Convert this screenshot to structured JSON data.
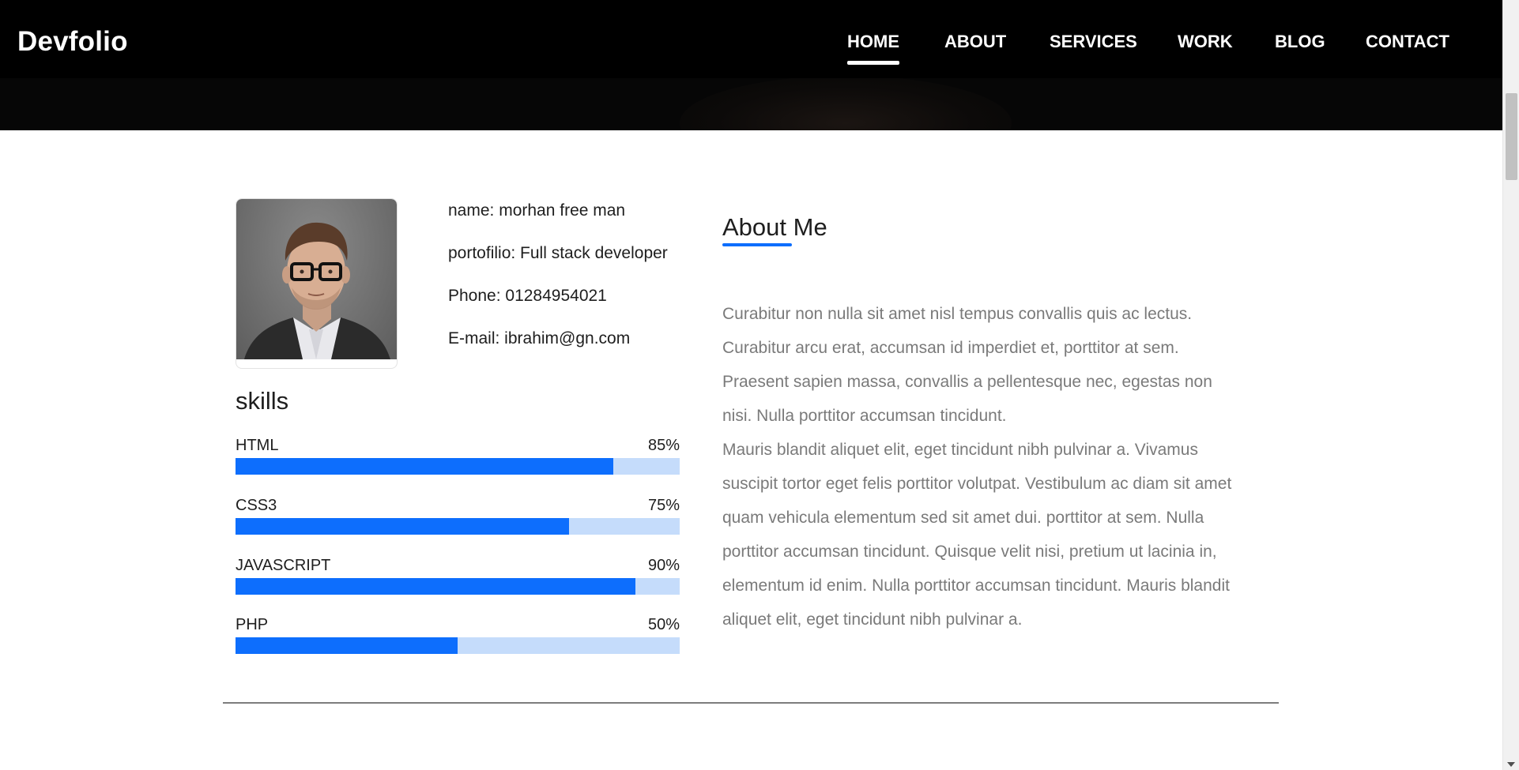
{
  "brand": "Devfolio",
  "nav": {
    "items": [
      {
        "label": "HOME",
        "active": true
      },
      {
        "label": "ABOUT",
        "active": false
      },
      {
        "label": "SERVICES",
        "active": false
      },
      {
        "label": "WORK",
        "active": false
      },
      {
        "label": "BLOG",
        "active": false
      },
      {
        "label": "CONTACT",
        "active": false
      }
    ]
  },
  "profile": {
    "avatar_alt": "profile photo",
    "name_line": "name: morhan free man",
    "portfolio_line": "portofilio: Full stack developer",
    "phone_line": "Phone: 01284954021",
    "email_line": "E-mail: ibrahim@gn.com"
  },
  "skills": {
    "title": "skills",
    "items": [
      {
        "label": "HTML",
        "percent_text": "85%",
        "value": 85
      },
      {
        "label": "CSS3",
        "percent_text": "75%",
        "value": 75
      },
      {
        "label": "JAVASCRIPT",
        "percent_text": "90%",
        "value": 90
      },
      {
        "label": "PHP",
        "percent_text": "50%",
        "value": 50
      }
    ]
  },
  "about": {
    "title": "About Me",
    "paragraphs": [
      "Curabitur non nulla sit amet nisl tempus convallis quis ac lectus. Curabitur arcu erat, accumsan id imperdiet et, porttitor at sem. Praesent sapien massa, convallis a pellentesque nec, egestas non nisi. Nulla porttitor accumsan tincidunt.",
      "Mauris blandit aliquet elit, eget tincidunt nibh pulvinar a. Vivamus suscipit tortor eget felis porttitor volutpat. Vestibulum ac diam sit amet quam vehicula elementum sed sit amet dui. porttitor at sem. Nulla porttitor accumsan tincidunt. Quisque velit nisi, pretium ut lacinia in, elementum id enim. Nulla porttitor accumsan tincidunt. Mauris blandit aliquet elit, eget tincidunt nibh pulvinar a."
    ]
  },
  "colors": {
    "accent": "#0d6efd",
    "accent_light": "#c5dcfb",
    "nav_bg": "#000000"
  }
}
